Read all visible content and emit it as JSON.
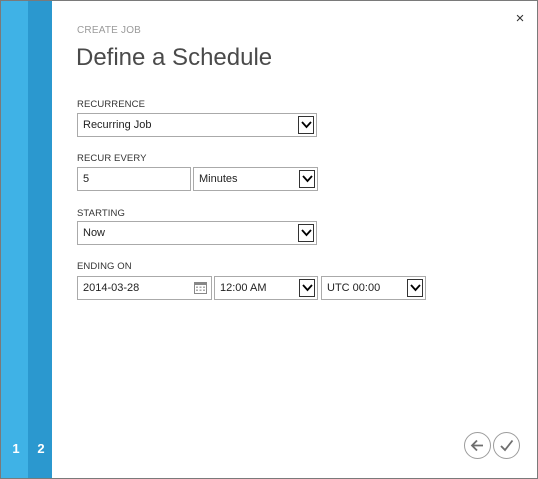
{
  "wizard": {
    "steps": [
      "1",
      "2"
    ],
    "close_glyph": "×"
  },
  "header": {
    "eyebrow": "CREATE JOB",
    "title": "Define a Schedule"
  },
  "form": {
    "recurrence": {
      "label": "RECURRENCE",
      "value": "Recurring Job"
    },
    "recur_every": {
      "label": "RECUR EVERY",
      "amount": "5",
      "unit": "Minutes"
    },
    "starting": {
      "label": "STARTING",
      "value": "Now"
    },
    "ending_on": {
      "label": "ENDING ON",
      "date": "2014-03-28",
      "time": "12:00 AM",
      "timezone": "UTC 00:00"
    }
  },
  "footer": {
    "back_icon": "arrow-left-icon",
    "done_icon": "checkmark-icon"
  },
  "colors": {
    "rail_light": "#3fb2e6",
    "rail_dark": "#2b98cf"
  }
}
